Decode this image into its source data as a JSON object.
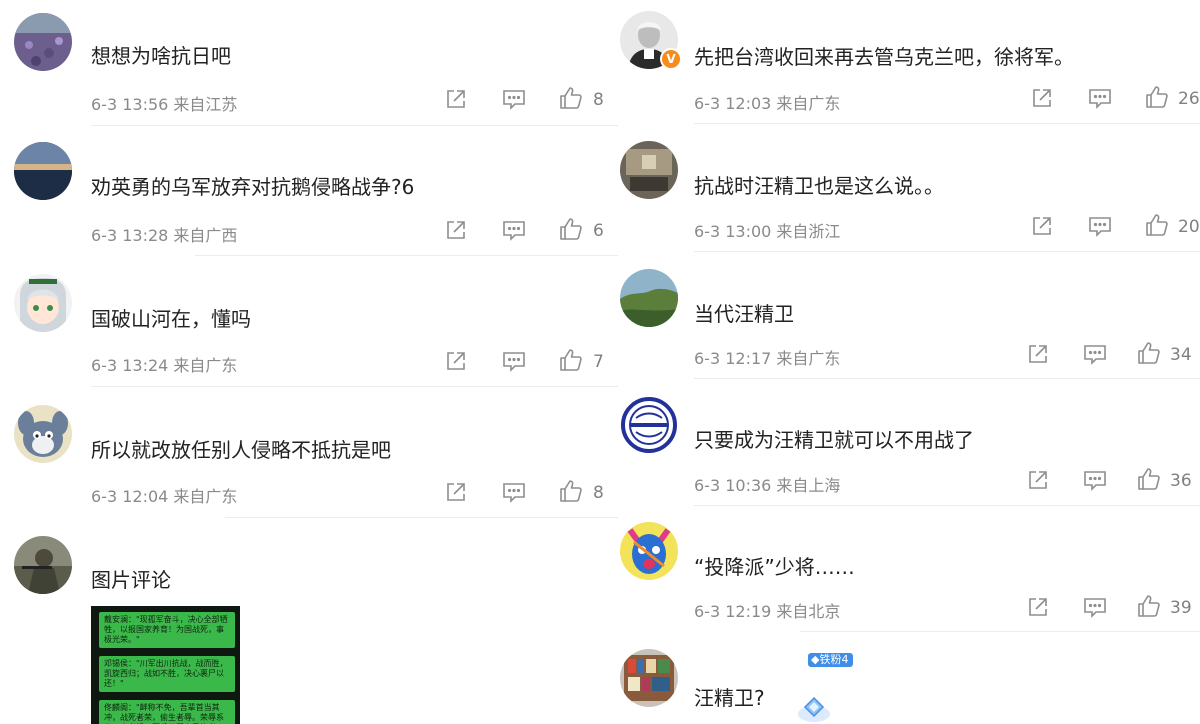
{
  "left": [
    {
      "text": "想想为啥抗日吧",
      "date": "6-3 13:56",
      "location": "来自江苏",
      "likes": "8"
    },
    {
      "text": "劝英勇的乌军放弃对抗鹅侵略战争?6",
      "date": "6-3 13:28",
      "location": "来自广西",
      "likes": "6"
    },
    {
      "text": "国破山河在，懂吗",
      "date": "6-3 13:24",
      "location": "来自广东",
      "likes": "7"
    },
    {
      "text": "所以就改放任别人侵略不抵抗是吧",
      "date": "6-3 12:04",
      "location": "来自广东",
      "likes": "8"
    },
    {
      "text": "图片评论",
      "image_lines": [
        "戴安澜：\"现孤军奋斗，决心全部牺牲，以报国家养育！为国战死，事极光荣。\"",
        "邓锡侯：\"川军出川抗战，战而胜，凯旋西归；战如不胜，决心裹尸以还！\"",
        "佟麟阁：\"衅称不免，吾辈首当其冲，战死者荣，偷生者辱。荣辱系于一人者轻，而系于国家民族者重。\""
      ]
    }
  ],
  "right": [
    {
      "text": "先把台湾收回来再去管乌克兰吧，徐将军。",
      "date": "6-3 12:03",
      "location": "来自广东",
      "likes": "26",
      "verified_badge": "V"
    },
    {
      "text": "抗战时汪精卫也是这么说。。",
      "date": "6-3 13:00",
      "location": "来自浙江",
      "likes": "20"
    },
    {
      "text": "当代汪精卫",
      "date": "6-3 12:17",
      "location": "来自广东",
      "likes": "34"
    },
    {
      "text": "只要成为汪精卫就可以不用战了",
      "date": "6-3 10:36",
      "location": "来自上海",
      "likes": "36"
    },
    {
      "text": "“投降派”少将……",
      "date": "6-3 12:19",
      "location": "来自北京",
      "likes": "39"
    },
    {
      "text": "汪精卫?",
      "fan_badge": "铁粉4"
    }
  ],
  "icons": {
    "share": "share-icon",
    "comment": "comment-icon",
    "like": "thumbs-up-icon"
  }
}
